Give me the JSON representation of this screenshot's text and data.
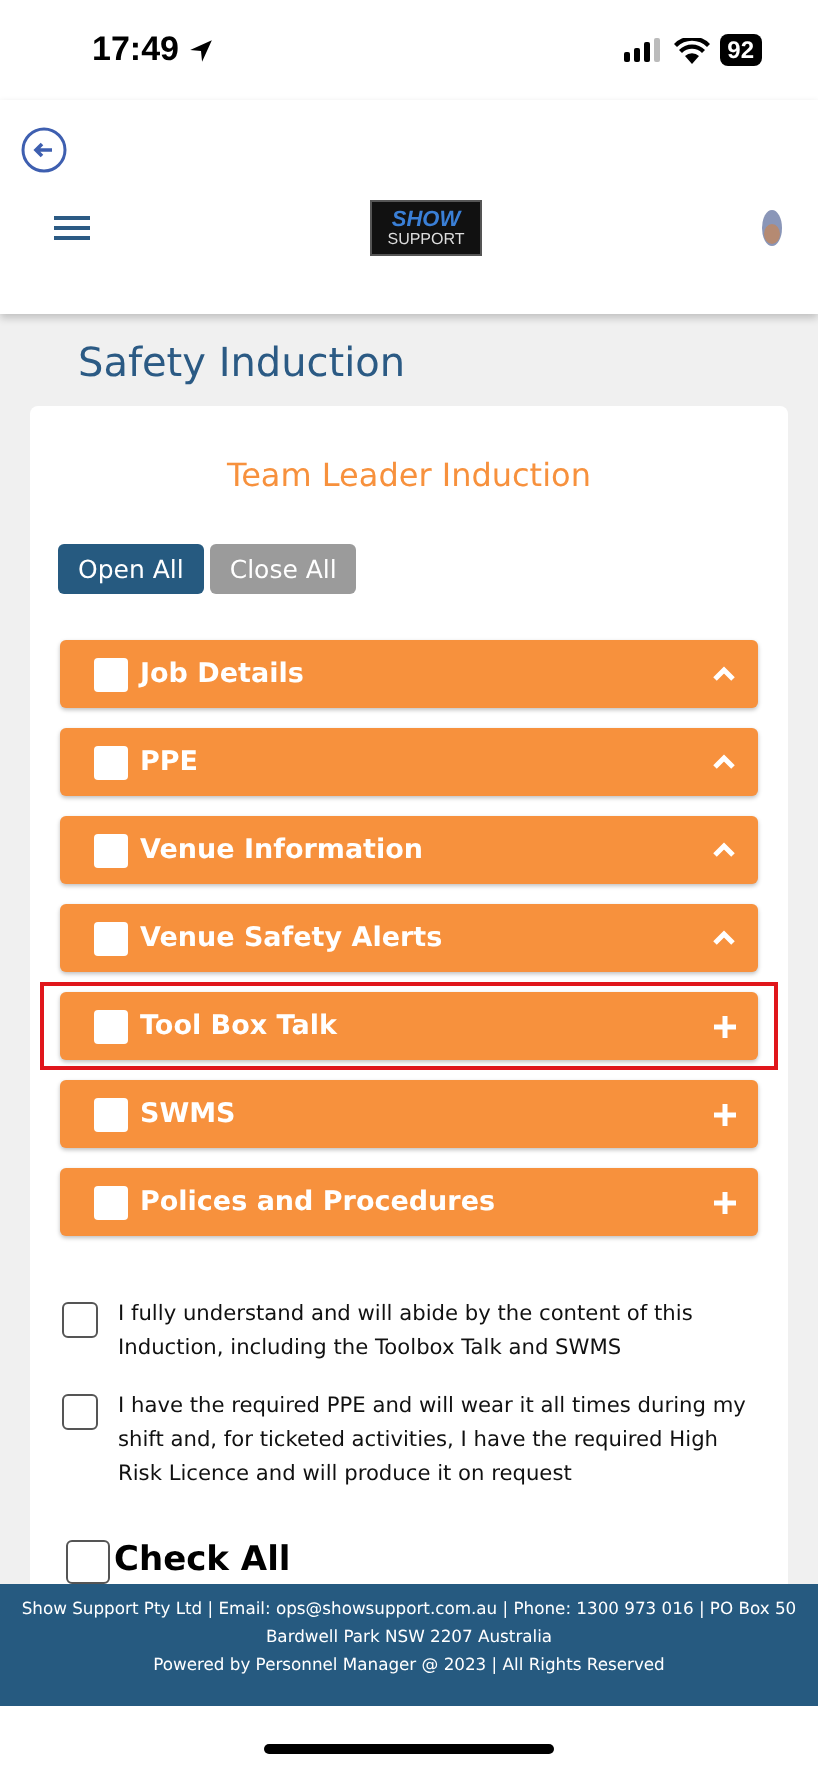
{
  "status_bar": {
    "time": "17:49",
    "battery": "92"
  },
  "header": {
    "logo_top": "SHOW",
    "logo_bottom": "SUPPORT"
  },
  "page_title": "Safety Induction",
  "card": {
    "title": "Team Leader Induction",
    "buttons": [
      {
        "label": "Open All",
        "kind": "primary"
      },
      {
        "label": "Close All",
        "kind": "secondary"
      }
    ],
    "sections": [
      {
        "title": "Job Details",
        "checked": false,
        "expanded": true,
        "highlighted": false
      },
      {
        "title": "PPE",
        "checked": false,
        "expanded": true,
        "highlighted": false
      },
      {
        "title": "Venue Information",
        "checked": false,
        "expanded": true,
        "highlighted": false
      },
      {
        "title": "Venue Safety Alerts",
        "checked": false,
        "expanded": true,
        "highlighted": false
      },
      {
        "title": "Tool Box Talk",
        "checked": false,
        "expanded": false,
        "highlighted": true
      },
      {
        "title": "SWMS",
        "checked": false,
        "expanded": false,
        "highlighted": false
      },
      {
        "title": "Polices and Procedures",
        "checked": false,
        "expanded": false,
        "highlighted": false
      }
    ],
    "agreements": [
      {
        "text": "I fully understand and will abide by the content of this Induction, including the Toolbox Talk and SWMS",
        "checked": false
      },
      {
        "text": "I have the required PPE and will wear it all times during my shift and, for ticketed activities, I have the required High Risk Licence and will produce it on request",
        "checked": false
      }
    ],
    "check_all": {
      "label": "Check All",
      "checked": false
    }
  },
  "footer": {
    "lines": [
      "Show Support Pty Ltd | Email: ops@showsupport.com.au | Phone: 1300 973 016 | PO Box 50 Bardwell Park NSW 2207 Australia",
      "Powered by Personnel Manager @ 2023 | All Rights Reserved"
    ]
  }
}
